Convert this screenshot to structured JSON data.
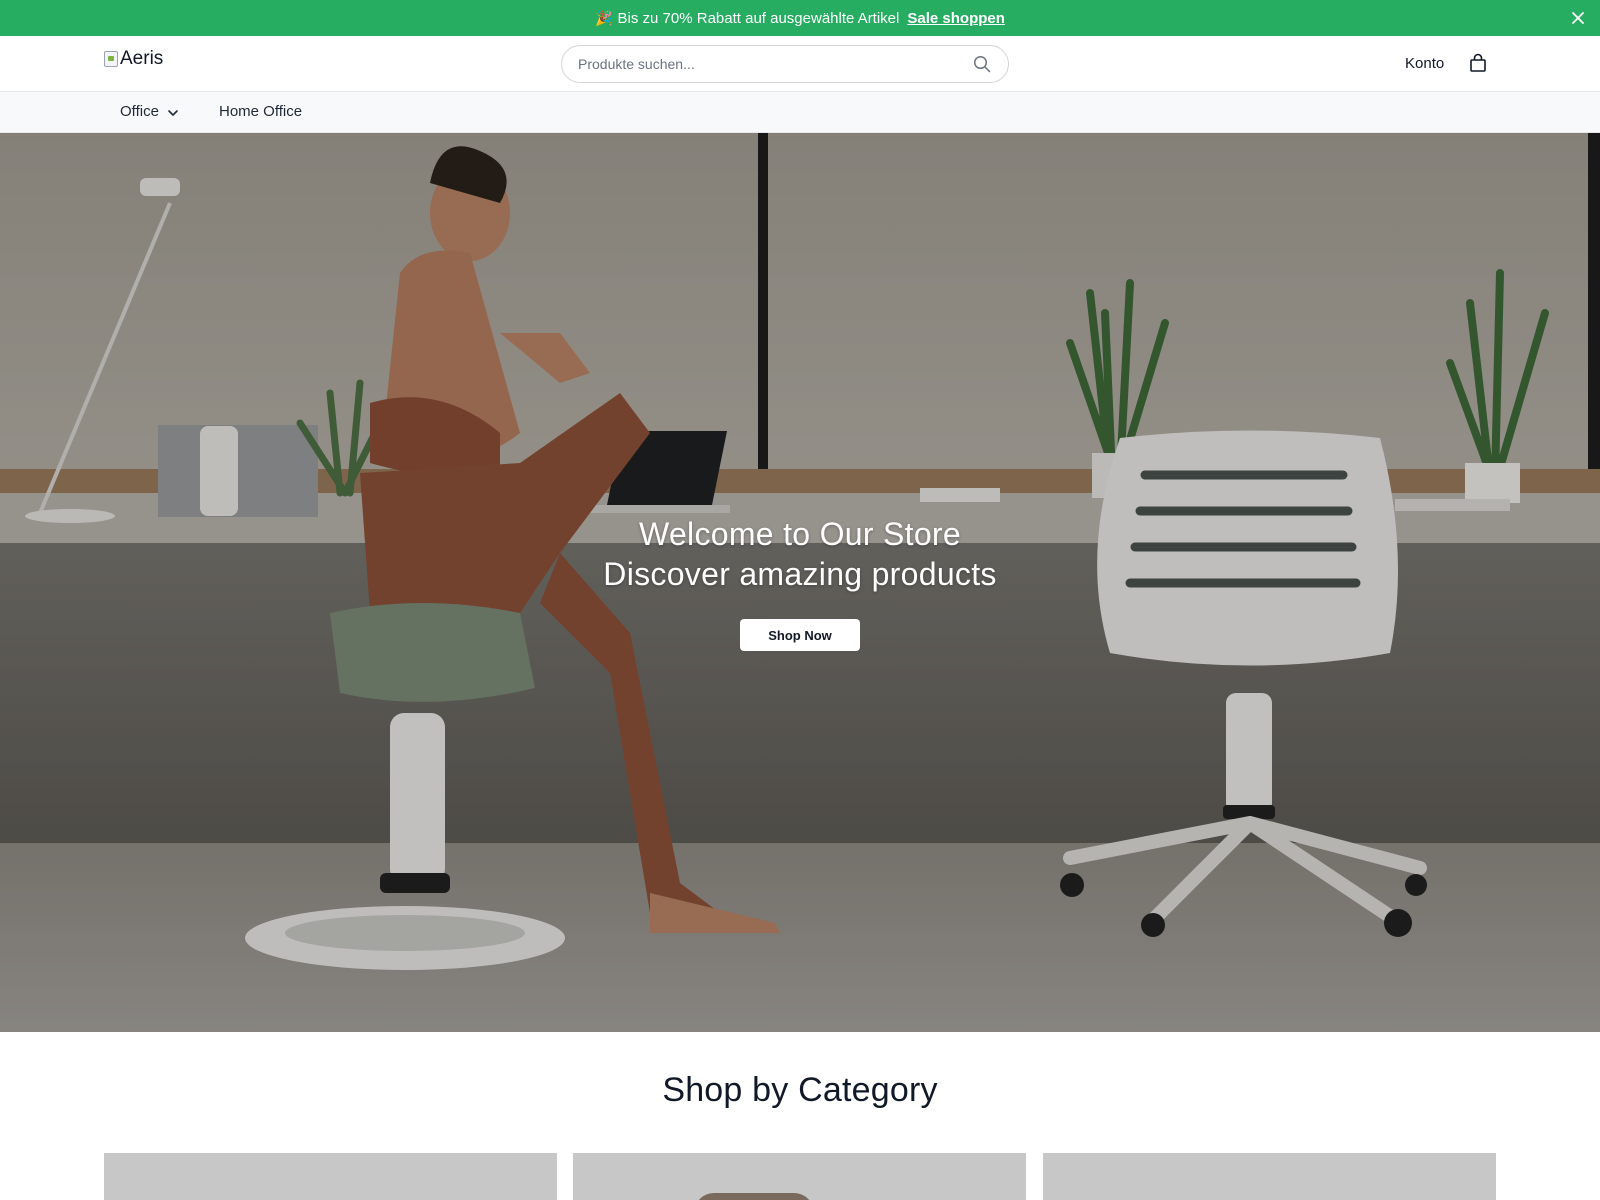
{
  "announcement": {
    "emoji": "🎉",
    "text": "Bis zu 70% Rabatt auf ausgewählte Artikel",
    "link_label": "Sale shoppen",
    "close_icon": "close-icon",
    "background_color": "#26ad61"
  },
  "header": {
    "logo_alt": "Aeris",
    "search": {
      "placeholder": "Produkte suchen...",
      "value": "",
      "icon": "search-icon"
    },
    "account_label": "Konto",
    "cart_icon": "shopping-bag-icon"
  },
  "nav": {
    "items": [
      {
        "label": "Office",
        "has_dropdown": true,
        "icon": "chevron-down-icon"
      },
      {
        "label": "Home Office",
        "has_dropdown": false
      }
    ]
  },
  "hero": {
    "title": "Welcome to Our Store",
    "subtitle": "Discover amazing products",
    "button_label": "Shop Now"
  },
  "categories": {
    "title": "Shop by Category",
    "cards": [
      {
        "image": "category-image"
      },
      {
        "image": "category-image"
      },
      {
        "image": "category-image"
      }
    ]
  }
}
